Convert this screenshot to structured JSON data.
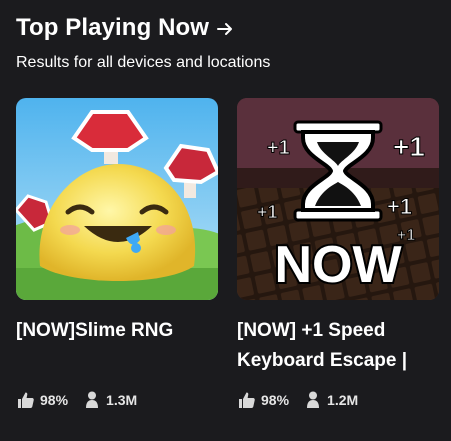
{
  "section": {
    "title": "Top Playing Now",
    "subtitle": "Results for all devices and locations",
    "arrow_icon": "arrow-right-icon"
  },
  "games": [
    {
      "title": "[NOW]Slime RNG",
      "like_ratio": "98%",
      "players": "1.3M",
      "thumbnail_icon": "slime-thumbnail"
    },
    {
      "title": "[NOW] +1 Speed Keyboard Escape |",
      "thumbnail_text": "NOW",
      "thumbnail_badges": [
        "+1",
        "+1",
        "+1",
        "+1",
        "+1"
      ],
      "like_ratio": "98%",
      "players": "1.2M",
      "thumbnail_icon": "hourglass-thumbnail"
    }
  ],
  "colors": {
    "background": "#1b1b1e",
    "text": "#ffffff",
    "stat_text": "#e6e6e6"
  }
}
